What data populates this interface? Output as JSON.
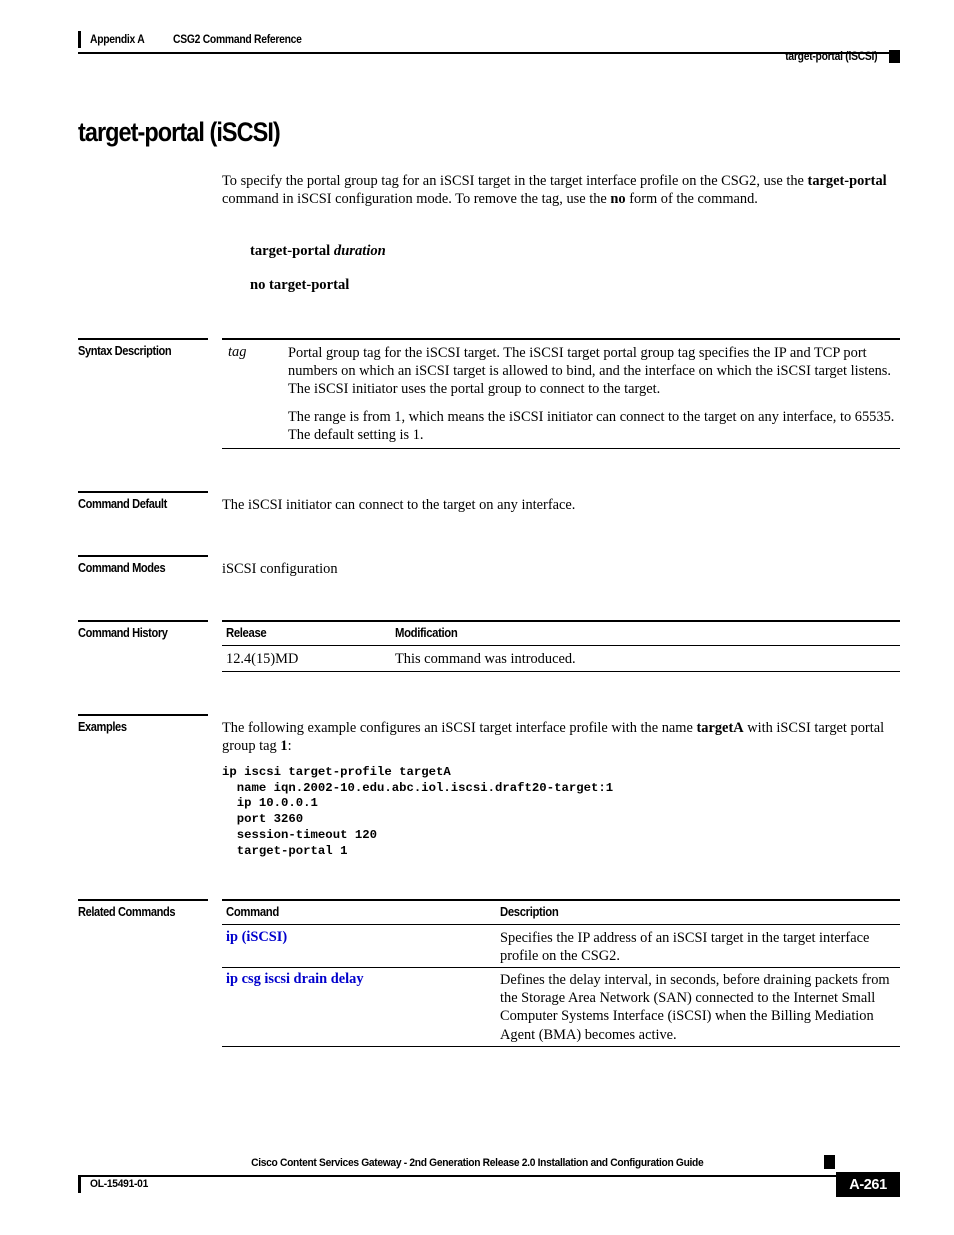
{
  "header": {
    "appendix": "Appendix A",
    "chapter": "CSG2 Command Reference",
    "running_head": "target-portal (iSCSI)"
  },
  "title": "target-portal (iSCSI)",
  "intro": {
    "part1": "To specify the portal group tag for an iSCSI target in the target interface profile on the CSG2, use the ",
    "bold1": "target-portal",
    "part2": " command in iSCSI configuration mode. To remove the tag, use the ",
    "bold2": "no",
    "part3": " form of the command."
  },
  "syntax": {
    "command": "target-portal",
    "argument": "duration",
    "no_form": "no target-portal"
  },
  "sections": {
    "syntax_description": "Syntax Description",
    "command_default": "Command Default",
    "command_modes": "Command Modes",
    "command_history": "Command History",
    "examples": "Examples",
    "related_commands": "Related Commands"
  },
  "syntax_description": {
    "term": "tag",
    "paragraph1": "Portal group tag for the iSCSI target. The iSCSI target portal group tag specifies the IP and TCP port numbers on which an iSCSI target is allowed to bind, and the interface on which the iSCSI target listens. The iSCSI initiator uses the portal group to connect to the target.",
    "paragraph2": "The range is from 1, which means the iSCSI initiator can connect to the target on any interface, to 65535. The default setting is 1."
  },
  "command_default": {
    "text": "The iSCSI initiator can connect to the target on any interface."
  },
  "command_modes": {
    "text": "iSCSI configuration"
  },
  "command_history": {
    "headers": [
      "Release",
      "Modification"
    ],
    "rows": [
      {
        "release": "12.4(15)MD",
        "modification": "This command was introduced."
      }
    ]
  },
  "examples": {
    "intro_part1": "The following example configures an iSCSI target interface profile with the name ",
    "intro_bold1": "targetA",
    "intro_part2": " with iSCSI target portal group tag ",
    "intro_bold2": "1",
    "intro_part3": ":",
    "code": "ip iscsi target-profile targetA\n  name iqn.2002-10.edu.abc.iol.iscsi.draft20-target:1\n  ip 10.0.0.1\n  port 3260\n  session-timeout 120\n  target-portal 1"
  },
  "related_commands": {
    "headers": [
      "Command",
      "Description"
    ],
    "rows": [
      {
        "command": "ip (iSCSI)",
        "description": "Specifies the IP address of an iSCSI target in the target interface profile on the CSG2."
      },
      {
        "command": "ip csg iscsi drain delay",
        "description": "Defines the delay interval, in seconds, before draining packets from the Storage Area Network (SAN) connected to the Internet Small Computer Systems Interface (iSCSI) when the Billing Mediation Agent (BMA) becomes active."
      }
    ]
  },
  "footer": {
    "doc_title": "Cisco Content Services Gateway - 2nd Generation Release 2.0 Installation and Configuration Guide",
    "doc_number": "OL-15491-01",
    "page_number": "A-261"
  },
  "colors": {
    "link": "#0000CC",
    "rule": "#000000"
  }
}
